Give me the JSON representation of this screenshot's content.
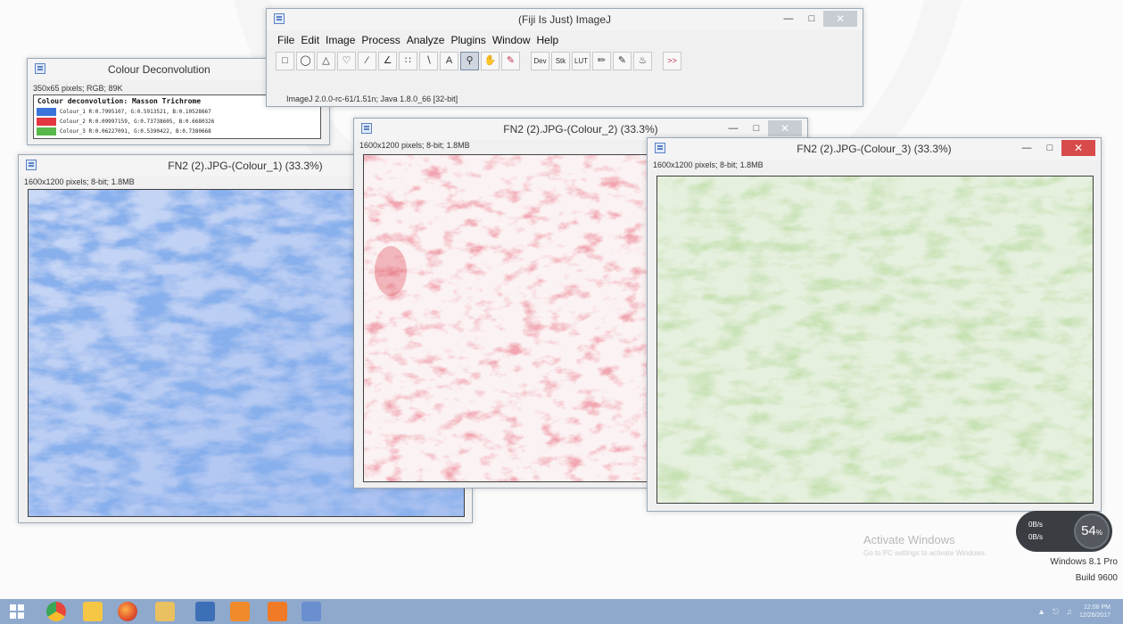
{
  "fiji": {
    "title": "(Fiji Is Just) ImageJ",
    "menu": [
      "File",
      "Edit",
      "Image",
      "Process",
      "Analyze",
      "Plugins",
      "Window",
      "Help"
    ],
    "status": "ImageJ 2.0.0-rc-61/1.51n; Java 1.8.0_66 [32-bit]",
    "tools": {
      "text": "A",
      "dev": "Dev",
      "stk": "Stk",
      "lut": "LUT",
      "more": ">>"
    }
  },
  "deconvolution": {
    "title": "Colour Deconvolution",
    "info": "350x65 pixels; RGB; 89K",
    "heading": "Colour deconvolution: Masson Trichrome",
    "rows": [
      {
        "label": "Colour_1 R:0.7995107, G:0.5913521, B:0.10528667",
        "color": "#3b73d8"
      },
      {
        "label": "Colour_2 R:0.09997159, G:0.73738605, B:0.6680326",
        "color": "#e3363f"
      },
      {
        "label": "Colour_3 R:0.06227091, G:0.5390422, B:0.7380668",
        "color": "#59b84a"
      }
    ]
  },
  "colour1": {
    "title": "FN2 (2).JPG-(Colour_1) (33.3%)",
    "info": "1600x1200 pixels; 8-bit; 1.8MB"
  },
  "colour2": {
    "title": "FN2 (2).JPG-(Colour_2) (33.3%)",
    "info": "1600x1200 pixels; 8-bit; 1.8MB"
  },
  "colour3": {
    "title": "FN2 (2).JPG-(Colour_3) (33.3%)",
    "info": "1600x1200 pixels; 8-bit; 1.8MB"
  },
  "desktop": {
    "activate_title": "Activate Windows",
    "activate_sub": "Go to PC settings to activate Windows.",
    "os_name": "Windows 8.1 Pro",
    "os_build": "Build 9600"
  },
  "widget": {
    "value": "54",
    "unit": "%",
    "line1": "0B/s",
    "line2": "0B/s"
  },
  "taskbar": {
    "time": "12:08 PM",
    "date": "12/26/2017"
  },
  "colors": {
    "colour1_stain": "#3f6fd6",
    "colour2_stain": "#e06070",
    "colour3_stain": "#8fbf70",
    "taskbar": "#8ea9cc"
  }
}
